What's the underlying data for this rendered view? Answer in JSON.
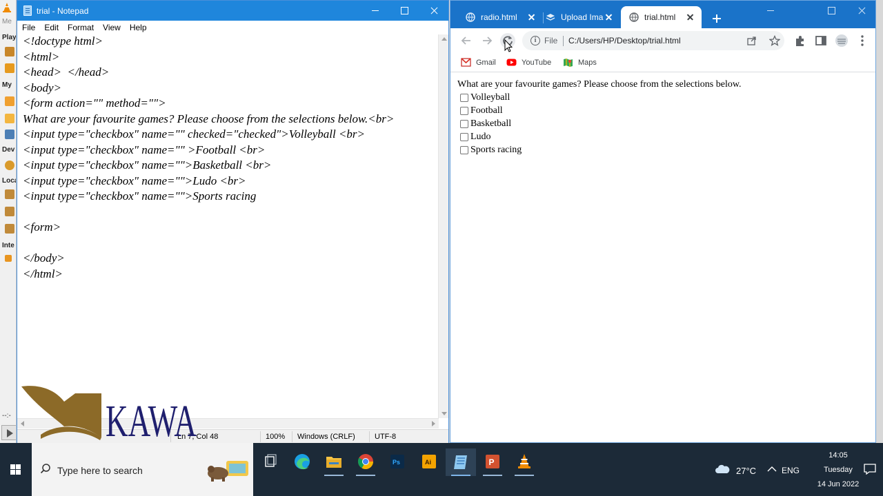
{
  "background_app": {
    "labels": [
      "Me",
      "Play",
      "My",
      "Dev",
      "Loca",
      "Inte",
      "--:-"
    ]
  },
  "notepad": {
    "title": "trial - Notepad",
    "menu": [
      "File",
      "Edit",
      "Format",
      "View",
      "Help"
    ],
    "lines": [
      "<!doctype html>",
      "<html>",
      "<head>  </head>",
      "<body>",
      "<form action=\"\" method=\"\">",
      "What are your favourite games? Please choose from the selections below.<br>",
      "<input type=\"checkbox\" name=\"\" checked=\"checked\">Volleyball <br>",
      "<input type=\"checkbox\" name=\"\" >Football <br>",
      "<input type=\"checkbox\" name=\"\">Basketball <br>",
      "<input type=\"checkbox\" name=\"\">Ludo <br>",
      "<input type=\"checkbox\" name=\"\">Sports racing",
      "",
      "<form>",
      "",
      "</body>",
      "</html>"
    ],
    "status": {
      "position": "Ln 7, Col 48",
      "zoom": "100%",
      "line_ending": "Windows (CRLF)",
      "encoding": "UTF-8"
    }
  },
  "watermark": {
    "text": "KAWA",
    "colors": {
      "mark": "#8c6a28",
      "text": "#1f1f6e"
    }
  },
  "browser": {
    "tabs": [
      {
        "label": "radio.html",
        "active": false,
        "icon": "globe-icon"
      },
      {
        "label": "Upload Ima",
        "active": false,
        "icon": "stack-icon"
      },
      {
        "label": "trial.html",
        "active": true,
        "icon": "globe-icon"
      }
    ],
    "address": {
      "scheme": "File",
      "url": "C:/Users/HP/Desktop/trial.html"
    },
    "bookmarks": [
      {
        "label": "Gmail",
        "icon": "gmail-icon"
      },
      {
        "label": "YouTube",
        "icon": "youtube-icon"
      },
      {
        "label": "Maps",
        "icon": "maps-icon"
      }
    ],
    "page": {
      "question": "What are your favourite games? Please choose from the selections below.",
      "options": [
        {
          "label": "Volleyball",
          "checked": false
        },
        {
          "label": "Football",
          "checked": false
        },
        {
          "label": "Basketball",
          "checked": false
        },
        {
          "label": "Ludo",
          "checked": false
        },
        {
          "label": "Sports racing",
          "checked": false
        }
      ]
    },
    "colors": {
      "tabstrip": "#1a73c9"
    }
  },
  "taskbar": {
    "search_placeholder": "Type here to search",
    "apps": [
      "file-explorer",
      "edge",
      "file-folder",
      "chrome",
      "photoshop",
      "illustrator",
      "notepad",
      "powerpoint",
      "vlc"
    ],
    "weather": "27°C",
    "language": "ENG",
    "time": "14:05",
    "day": "Tuesday",
    "date": "14 Jun 2022"
  }
}
